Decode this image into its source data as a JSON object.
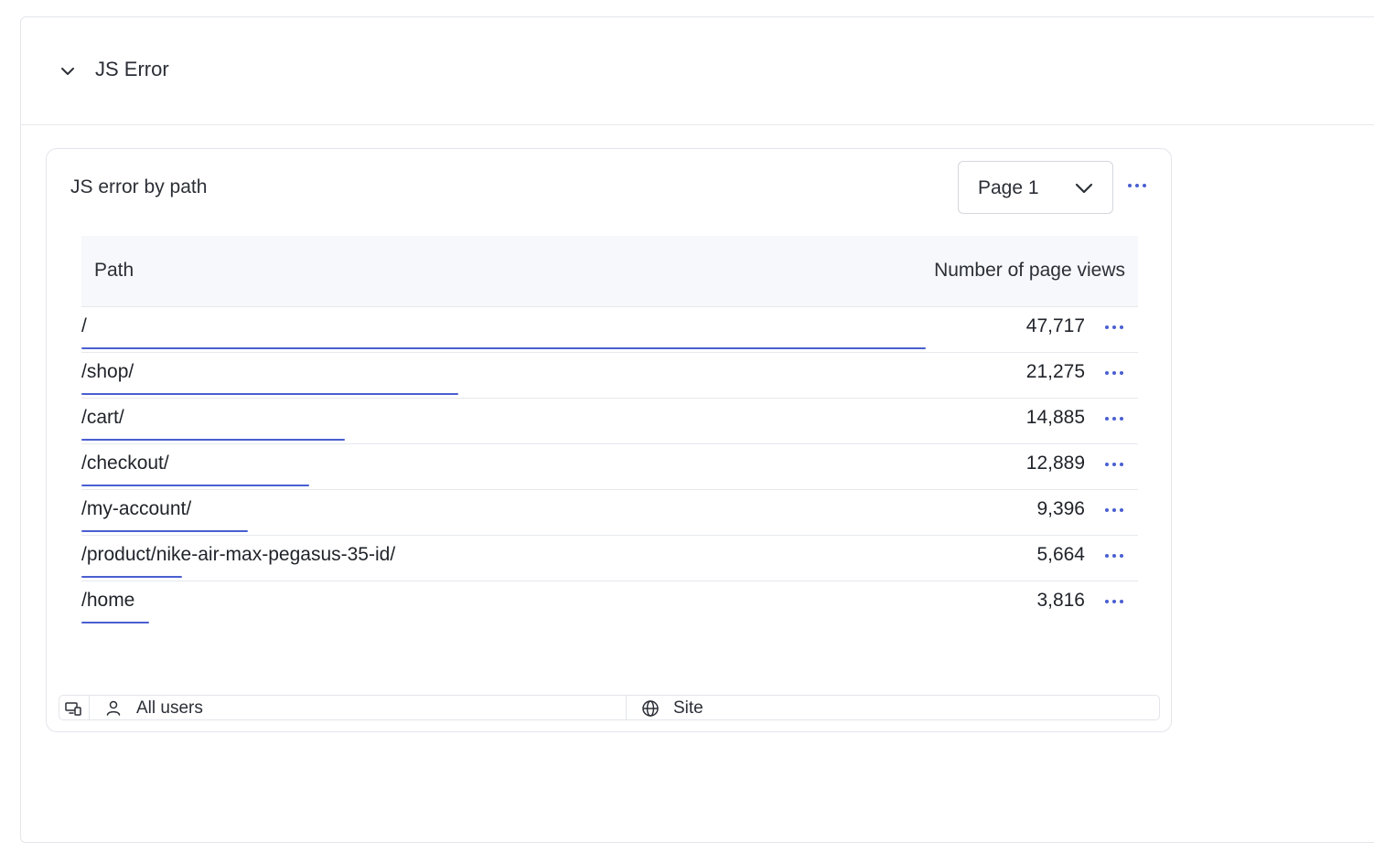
{
  "section": {
    "title": "JS Error",
    "collapse_icon": "chevron-down-icon"
  },
  "card": {
    "title": "JS error by path",
    "page_select": {
      "value": "Page 1",
      "icon": "chevron-down-icon"
    },
    "more_icon": "more-horizontal-icon"
  },
  "table": {
    "columns": [
      "Path",
      "Number of page views"
    ],
    "rows": [
      {
        "path": "/",
        "views": "47,717",
        "share": 1.0
      },
      {
        "path": "/shop/",
        "views": "21,275",
        "share": 0.446
      },
      {
        "path": "/cart/",
        "views": "14,885",
        "share": 0.312
      },
      {
        "path": "/checkout/",
        "views": "12,889",
        "share": 0.27
      },
      {
        "path": "/my-account/",
        "views": "9,396",
        "share": 0.197
      },
      {
        "path": "/product/nike-air-max-pegasus-35-id/",
        "views": "5,664",
        "share": 0.119
      },
      {
        "path": "/home",
        "views": "3,816",
        "share": 0.08
      }
    ],
    "row_more_icon": "more-horizontal-icon"
  },
  "footer": {
    "device_icon": "devices-icon",
    "users_icon": "user-icon",
    "users_label": "All users",
    "site_icon": "globe-icon",
    "site_label": "Site"
  },
  "colors": {
    "accent": "#4a5fd1",
    "border": "#e3e5ea",
    "header_bg": "#f7f8fb"
  }
}
